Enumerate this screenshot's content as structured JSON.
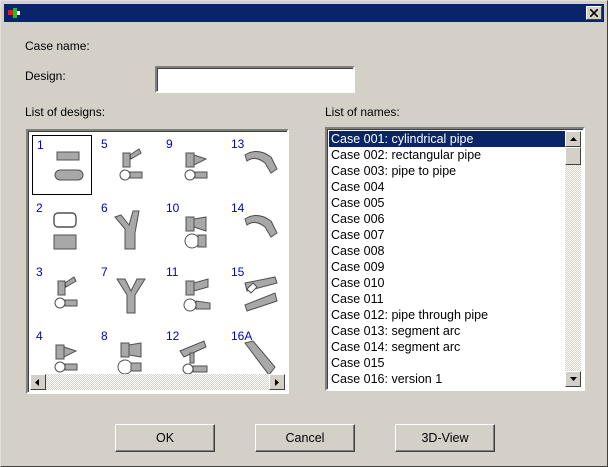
{
  "window": {
    "title": ""
  },
  "labels": {
    "case_name": "Case name:",
    "design": "Design:",
    "list_of_designs": "List of designs:",
    "list_of_names": "List of names:"
  },
  "design_field": {
    "value": ""
  },
  "designs": [
    "1",
    "5",
    "9",
    "13",
    "2",
    "6",
    "10",
    "14",
    "3",
    "7",
    "11",
    "15",
    "4",
    "8",
    "12",
    "16A"
  ],
  "names": [
    "Case 001: cylindrical pipe",
    "Case 002: rectangular pipe",
    "Case 003: pipe to pipe",
    "Case 004",
    "Case 005",
    "Case 006",
    "Case 007",
    "Case 008",
    "Case 009",
    "Case 010",
    "Case 011",
    "Case 012: pipe through pipe",
    "Case 013: segment arc",
    "Case 014: segment arc",
    "Case 015",
    "Case 016: version 1"
  ],
  "buttons": {
    "ok": "OK",
    "cancel": "Cancel",
    "view3d": "3D-View"
  }
}
